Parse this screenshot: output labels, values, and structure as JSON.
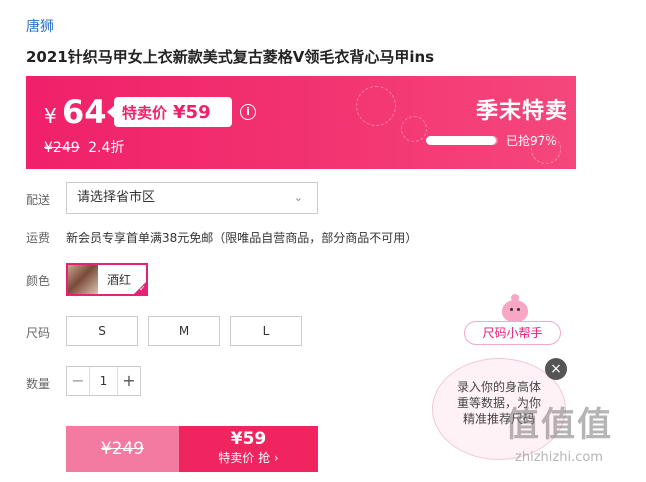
{
  "brand": "唐狮",
  "product_title": "2021针织马甲女上衣新款美式复古菱格V领毛衣背心马甲ins",
  "banner": {
    "currency": "¥",
    "price": "64",
    "special_label": "特卖价",
    "special_price": "¥59",
    "info_icon": "info-icon",
    "original_price": "¥249",
    "discount": "2.4折",
    "season_label": "季末特卖",
    "sold_text": "已抢97%",
    "sold_fraction": 0.97,
    "accent": "#f0206a"
  },
  "delivery": {
    "label": "配送",
    "select_value": "请选择省市区",
    "chevron_icon": "chevron-down-icon"
  },
  "shipping": {
    "label": "运费",
    "text": "新会员专享首单满38元免邮（限唯品自营商品，部分商品不可用）"
  },
  "color": {
    "label": "颜色",
    "options": [
      {
        "name": "酒红",
        "selected": true
      }
    ]
  },
  "size": {
    "label": "尺码",
    "options": [
      "S",
      "M",
      "L"
    ]
  },
  "quantity": {
    "label": "数量",
    "minus": "−",
    "value": "1",
    "plus": "+"
  },
  "buy": {
    "original": "¥249",
    "price": "¥59",
    "action": "特卖价 抢 ›"
  },
  "size_helper": {
    "pill": "尺码小帮手",
    "bubble_line1": "录入你的身高体",
    "bubble_line2": "重等数据，为你",
    "bubble_line3": "精准推荐尺码",
    "close": "×"
  },
  "watermark": {
    "logo": "值值值",
    "url": "zhizhizhi.com"
  }
}
